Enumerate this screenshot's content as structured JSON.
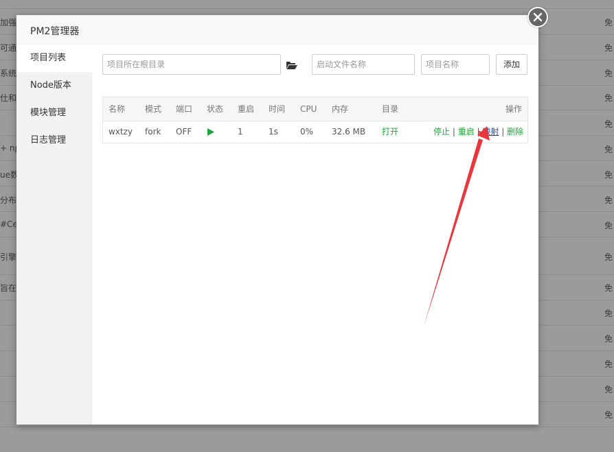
{
  "background": {
    "left_fragments": [
      "加强",
      "可通",
      "系统",
      "仕和",
      "+ npm",
      "ue数",
      "分布式",
      "#Cen",
      "引擎",
      "旨在"
    ],
    "right_fragments": [
      "免",
      "免",
      "免",
      "免",
      "免",
      "免",
      "免",
      "免",
      "免",
      "免",
      "免",
      "免",
      "免",
      "免",
      "免",
      "免"
    ]
  },
  "modal": {
    "title": "PM2管理器"
  },
  "sidebar": {
    "items": [
      {
        "label": "项目列表",
        "active": true
      },
      {
        "label": "Node版本",
        "active": false
      },
      {
        "label": "模块管理",
        "active": false
      },
      {
        "label": "日志管理",
        "active": false
      }
    ]
  },
  "form": {
    "root_dir_placeholder": "项目所在根目录",
    "start_file_placeholder": "启动文件名称",
    "project_name_placeholder": "项目名称",
    "add_label": "添加"
  },
  "table": {
    "headers": [
      "名称",
      "模式",
      "端口",
      "状态",
      "重启",
      "时间",
      "CPU",
      "内存",
      "目录",
      "操作"
    ],
    "rows": [
      {
        "name": "wxtzy",
        "mode": "fork",
        "port": "OFF",
        "status": "running",
        "restarts": "1",
        "time": "1s",
        "cpu": "0%",
        "memory": "32.6 MB",
        "dir_action": "打开",
        "actions": [
          "停止",
          "重启",
          "映射",
          "删除"
        ]
      }
    ]
  },
  "colors": {
    "accent_green": "#20a53a",
    "annotation_red": "#e8383d",
    "link_blue": "#1f4aa8"
  }
}
